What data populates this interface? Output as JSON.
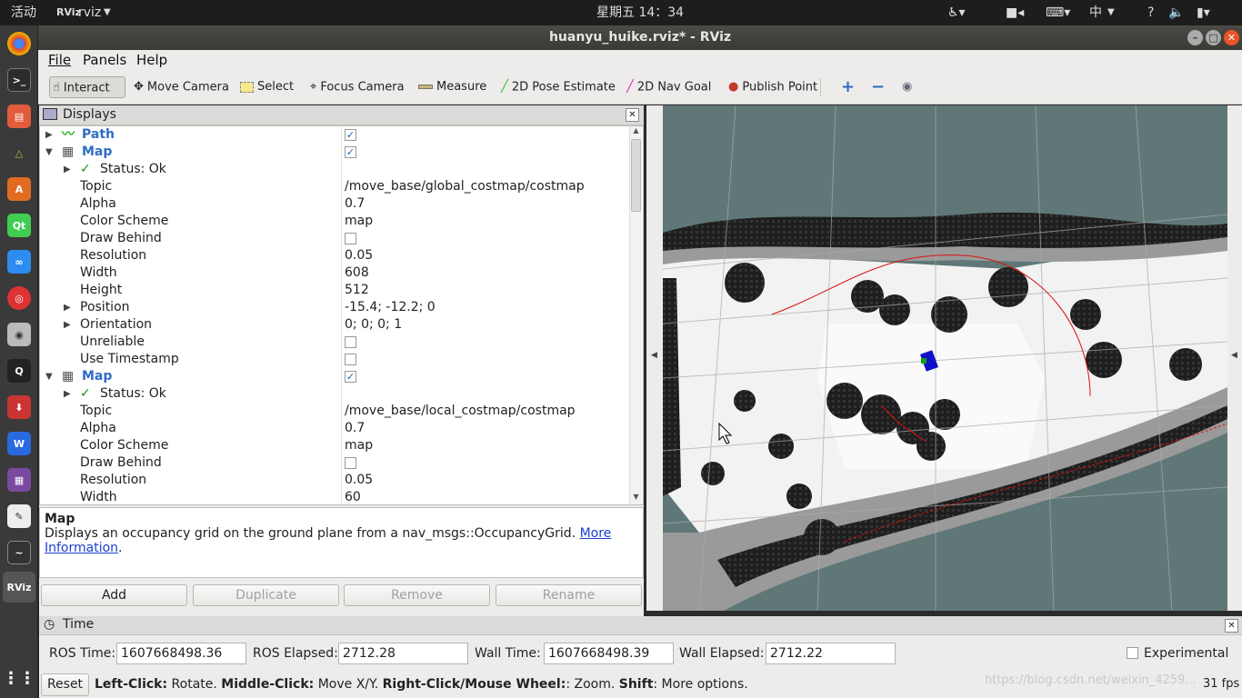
{
  "topbar": {
    "activities": "活动",
    "app_name": "rviz",
    "clock": "星期五 14：34",
    "input_method": "中"
  },
  "window": {
    "title": "huanyu_huike.rviz* - RViz"
  },
  "menubar": {
    "file": "File",
    "panels": "Panels",
    "help": "Help"
  },
  "toolbar": {
    "interact": "Interact",
    "move_camera": "Move Camera",
    "select": "Select",
    "focus_camera": "Focus Camera",
    "measure": "Measure",
    "pose_estimate": "2D Pose Estimate",
    "nav_goal": "2D Nav Goal",
    "publish_point": "Publish Point"
  },
  "displays": {
    "title": "Displays",
    "rows": [
      {
        "label": "Path",
        "value": ""
      },
      {
        "label": "Map",
        "value": ""
      },
      {
        "label": "Status: Ok",
        "value": ""
      },
      {
        "label": "Topic",
        "value": "/move_base/global_costmap/costmap"
      },
      {
        "label": "Alpha",
        "value": "0.7"
      },
      {
        "label": "Color Scheme",
        "value": "map"
      },
      {
        "label": "Draw Behind",
        "value": ""
      },
      {
        "label": "Resolution",
        "value": "0.05"
      },
      {
        "label": "Width",
        "value": "608"
      },
      {
        "label": "Height",
        "value": "512"
      },
      {
        "label": "Position",
        "value": "-15.4; -12.2; 0"
      },
      {
        "label": "Orientation",
        "value": "0; 0; 0; 1"
      },
      {
        "label": "Unreliable",
        "value": ""
      },
      {
        "label": "Use Timestamp",
        "value": ""
      },
      {
        "label": "Map",
        "value": ""
      },
      {
        "label": "Status: Ok",
        "value": ""
      },
      {
        "label": "Topic",
        "value": "/move_base/local_costmap/costmap"
      },
      {
        "label": "Alpha",
        "value": "0.7"
      },
      {
        "label": "Color Scheme",
        "value": "map"
      },
      {
        "label": "Draw Behind",
        "value": ""
      },
      {
        "label": "Resolution",
        "value": "0.05"
      },
      {
        "label": "Width",
        "value": "60"
      }
    ],
    "desc_title": "Map",
    "desc_text": "Displays an occupancy grid on the ground plane from a nav_msgs::OccupancyGrid.",
    "desc_link_1": "More",
    "desc_link_2": "Information",
    "desc_end": ".",
    "buttons": {
      "add": "Add",
      "duplicate": "Duplicate",
      "remove": "Remove",
      "rename": "Rename"
    }
  },
  "time": {
    "title": "Time",
    "ros_time_label": "ROS Time:",
    "ros_time": "1607668498.36",
    "ros_elapsed_label": "ROS Elapsed:",
    "ros_elapsed": "2712.28",
    "wall_time_label": "Wall Time:",
    "wall_time": "1607668498.39",
    "wall_elapsed_label": "Wall Elapsed:",
    "wall_elapsed": "2712.22",
    "experimental": "Experimental"
  },
  "statusbar": {
    "reset": "Reset",
    "left_click": "Left-Click:",
    "rotate": " Rotate. ",
    "middle_click": "Middle-Click:",
    "move": " Move X/Y. ",
    "right_click": "Right-Click/Mouse Wheel:",
    "zoom": ": Zoom. ",
    "shift": "Shift",
    "more": ": More options.",
    "watermark": "https://blog.csdn.net/weixin_4259...",
    "fps": "31 fps"
  },
  "colors": {
    "accent_blue": "#2e6cc4",
    "viewport_bg": "#5f7777",
    "path_green": "#1ec41e"
  }
}
